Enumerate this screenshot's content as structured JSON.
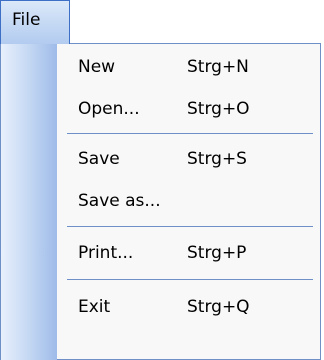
{
  "menubar": {
    "file_label": "File"
  },
  "menu": {
    "items": [
      {
        "label": "New",
        "shortcut": "Strg+N"
      },
      {
        "label": "Open...",
        "shortcut": "Strg+O"
      },
      {
        "label": "Save",
        "shortcut": "Strg+S"
      },
      {
        "label": "Save as...",
        "shortcut": ""
      },
      {
        "label": "Print...",
        "shortcut": "Strg+P"
      },
      {
        "label": "Exit",
        "shortcut": "Strg+Q"
      }
    ]
  },
  "colors": {
    "accent": "#6e8fc7",
    "gutter": "#9ebbe9",
    "menu_background": "#f8f8f8"
  }
}
